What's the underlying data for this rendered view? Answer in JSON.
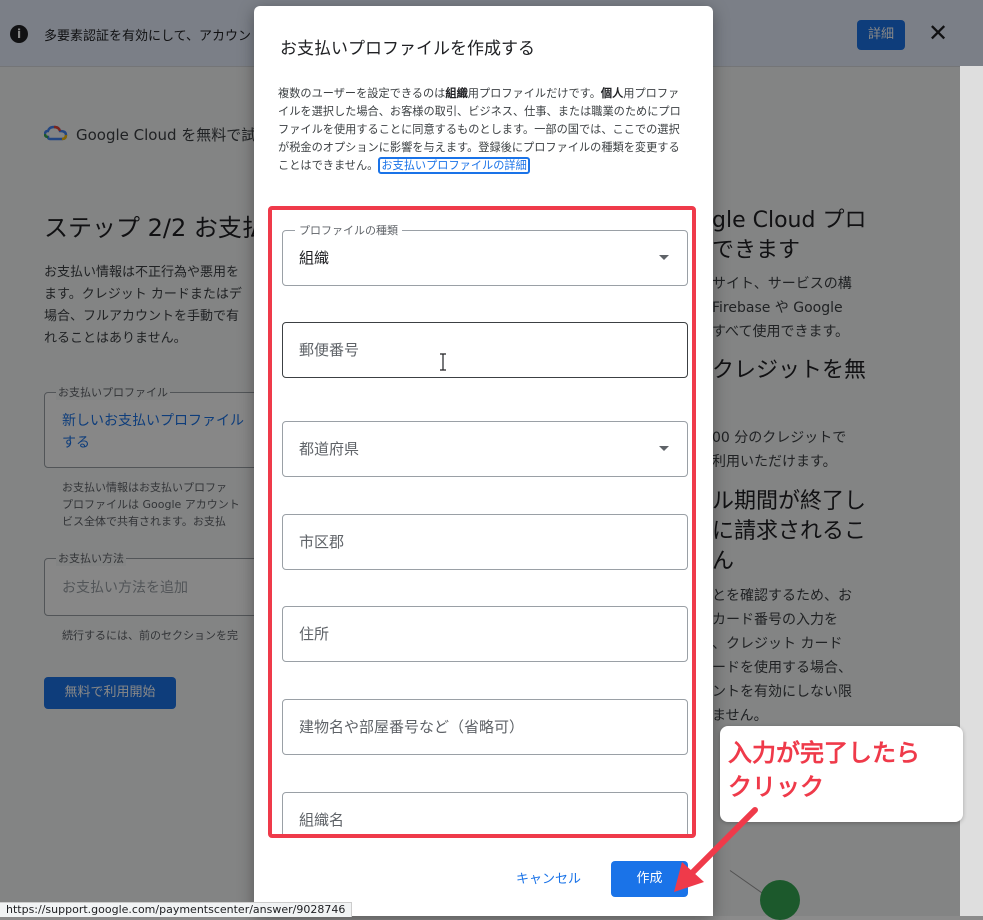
{
  "banner": {
    "info_icon": "i",
    "message": "多要素認証を有効にして、アカウン",
    "detail_button": "詳細",
    "close_icon": "✕"
  },
  "background": {
    "product_title": "Google Cloud を無料で試",
    "step_title": "ステップ 2/2 お支払",
    "step_description": "お支払い情報は不正行為や悪用を\nます。クレジット カードまたはデ\n場合、フルアカウントを手動で有\nれることはありません。",
    "payment_profile": {
      "legend": "お支払いプロファイル",
      "value": "新しいお支払いプロファイル\nする",
      "note": "お支払い情報はお支払いプロファ\nプロファイルは Google アカウント\nビス全体で共有されます。お支払"
    },
    "payment_method": {
      "legend": "お支払い方法",
      "placeholder": "お支払い方法を追加",
      "continue_note": "続行するには、前のセクションを完"
    },
    "start_button": "無料で利用開始",
    "right_column": {
      "t1": "gle Cloud プロ\nできます",
      "t2": "サイト、サービスの構\nFirebase や Google\nすべて使用できます。",
      "t3": "クレジットを無",
      "t4": "00 分のクレジットで\n利用いただけます。",
      "t5": "ル期間が終了し\nに請求されるこ\nん",
      "t6": "とを確認するため、お\nカード番号の入力を\n、クレジット カード\nードを使用する場合、\nントを有効にしない限\nません。"
    },
    "status_url": "https://support.google.com/paymentscenter/answer/9028746"
  },
  "dialog": {
    "title": "お支払いプロファイルを作成する",
    "desc_1": "複数のユーザーを設定できるのは",
    "desc_bold_1": "組織",
    "desc_2": "用プロファイルだけです。",
    "desc_bold_2": "個人",
    "desc_3": "用プロファイルを選択した場合、お客様の取引、ビジネス、仕事、または職業のためにプロファイルを使用することに同意するものとします。一部の国では、ここでの選択が税金のオプションに影響を与えます。登録後にプロファイルの種類を変更することはできません。",
    "help_link": "お支払いプロファイルの詳細",
    "fields": {
      "profile_type_legend": "プロファイルの種類",
      "profile_type_value": "組織",
      "postal_code": "郵便番号",
      "prefecture": "都道府県",
      "city": "市区郡",
      "address": "住所",
      "building": "建物名や部屋番号など（省略可）",
      "org_name": "組織名"
    },
    "cancel_button": "キャンセル",
    "create_button": "作成"
  },
  "annotation": {
    "callout": "入力が完了したら\nクリック",
    "color": "#ef3a4a"
  }
}
